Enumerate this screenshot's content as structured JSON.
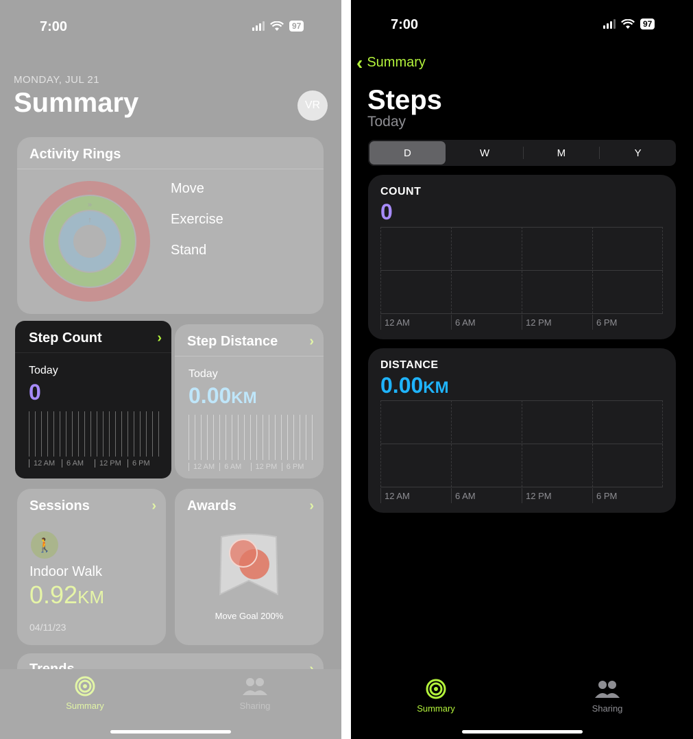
{
  "status_bar": {
    "time": "7:00",
    "battery": "97"
  },
  "left": {
    "date": "MONDAY, JUL 21",
    "title": "Summary",
    "avatar": "VR",
    "activity": {
      "title": "Activity Rings",
      "labels": [
        "Move",
        "Exercise",
        "Stand"
      ]
    },
    "step_count": {
      "title": "Step Count",
      "period": "Today",
      "value": "0",
      "ticks": [
        "12 AM",
        "6 AM",
        "12 PM",
        "6 PM"
      ]
    },
    "step_distance": {
      "title": "Step Distance",
      "period": "Today",
      "value": "0.00",
      "unit": "KM",
      "ticks": [
        "12 AM",
        "6 AM",
        "12 PM",
        "6 PM"
      ]
    },
    "sessions": {
      "title": "Sessions",
      "workout": "Indoor Walk",
      "value": "0.92",
      "unit": "KM",
      "date": "04/11/23"
    },
    "awards": {
      "title": "Awards",
      "label": "Move Goal 200%"
    },
    "trends": {
      "title": "Trends"
    },
    "tabs": [
      "Summary",
      "Sharing"
    ]
  },
  "right": {
    "back_label": "Summary",
    "title": "Steps",
    "subtitle": "Today",
    "segments": [
      "D",
      "W",
      "M",
      "Y"
    ],
    "count": {
      "label": "COUNT",
      "value": "0"
    },
    "distance": {
      "label": "DISTANCE",
      "value": "0.00",
      "unit": "KM"
    },
    "x_ticks": [
      "12 AM",
      "6 AM",
      "12 PM",
      "6 PM"
    ],
    "tabs": [
      "Summary",
      "Sharing"
    ]
  },
  "colors": {
    "accent": "#b3f33b",
    "count": "#a78bfa",
    "distance": "#1fb4ff",
    "move_ring": "#c98e8e",
    "exercise_ring": "#a4c48a",
    "stand_ring": "#9fb9c9"
  },
  "icons": [
    "back-chevron-icon",
    "activity-rings-icon",
    "sharing-icon",
    "walk-icon",
    "award-badge-icon",
    "wifi-icon",
    "signal-icon",
    "battery-icon",
    "chevron-right-icon"
  ]
}
